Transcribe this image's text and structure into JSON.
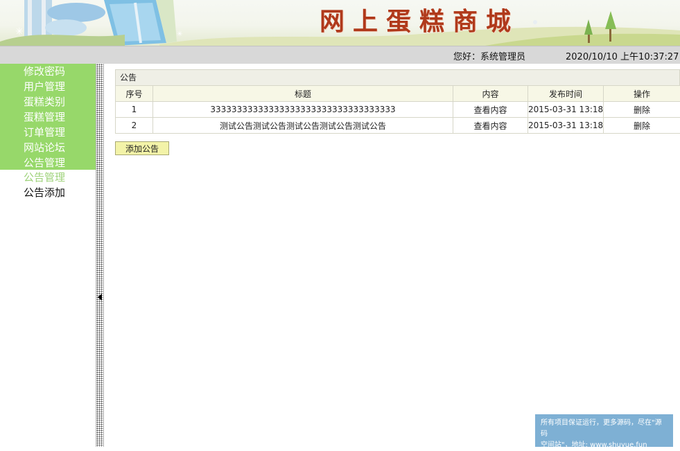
{
  "header": {
    "site_title": "网上蛋糕商城",
    "greeting": "您好：系统管理员",
    "datetime": "2020/10/10 上午10:37:27",
    "colors": {
      "title": "#b0391b",
      "menu_bg": "#97d86a",
      "userbar_bg": "#d8d8d8"
    }
  },
  "sidebar": {
    "items": [
      {
        "label": "修改密码"
      },
      {
        "label": "用户管理"
      },
      {
        "label": "蛋糕类别"
      },
      {
        "label": "蛋糕管理"
      },
      {
        "label": "订单管理"
      },
      {
        "label": "网站论坛"
      },
      {
        "label": "公告管理"
      }
    ],
    "sub_items": [
      {
        "label": "公告管理",
        "active": true
      },
      {
        "label": "公告添加",
        "active": false
      }
    ]
  },
  "splitter": {
    "icon": "collapse-arrow-icon"
  },
  "main": {
    "panel_title": "公告",
    "columns": [
      "序号",
      "标题",
      "内容",
      "发布时间",
      "操作"
    ],
    "rows": [
      {
        "index": "1",
        "title": "33333333333333333333333333333333333",
        "content": "查看内容",
        "time": "2015-03-31 13:18",
        "action": "删除"
      },
      {
        "index": "2",
        "title": "测试公告测试公告测试公告测试公告测试公告",
        "content": "查看内容",
        "time": "2015-03-31 13:18",
        "action": "删除"
      }
    ],
    "add_button": "添加公告"
  },
  "footer_notice": {
    "line1": "所有项目保证运行，更多源码，尽在\"源码",
    "line2": "空间站\"，地址: www.shuyue.fun"
  }
}
